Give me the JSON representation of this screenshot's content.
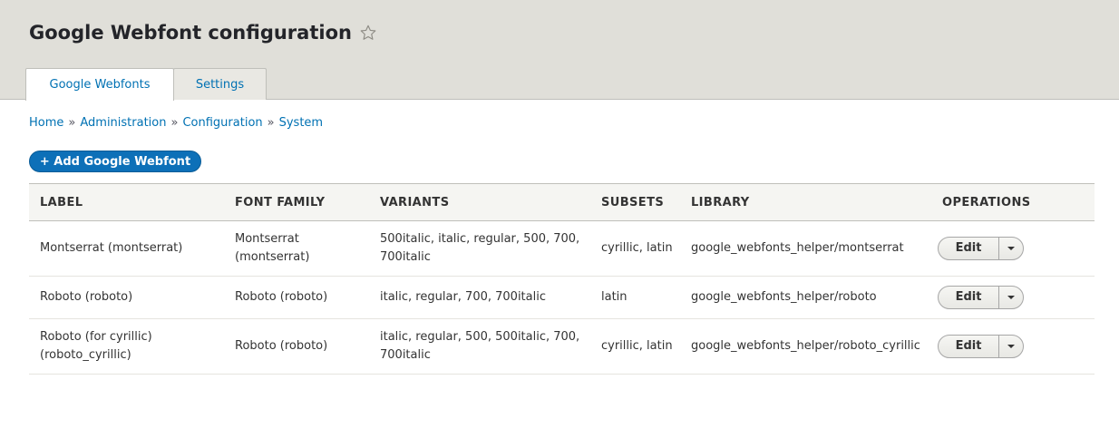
{
  "page": {
    "title": "Google Webfont configuration"
  },
  "tabs": [
    {
      "label": "Google Webfonts",
      "active": true
    },
    {
      "label": "Settings",
      "active": false
    }
  ],
  "breadcrumb": {
    "items": [
      "Home",
      "Administration",
      "Configuration",
      "System"
    ],
    "separator": "»"
  },
  "actions": {
    "add_label": "+ Add Google Webfont"
  },
  "table": {
    "columns": [
      "LABEL",
      "FONT FAMILY",
      "VARIANTS",
      "SUBSETS",
      "LIBRARY",
      "OPERATIONS"
    ],
    "rows": [
      {
        "label": "Montserrat (montserrat)",
        "font_family": "Montserrat (montserrat)",
        "variants": "500italic, italic, regular, 500, 700, 700italic",
        "subsets": "cyrillic, latin",
        "library": "google_webfonts_helper/montserrat",
        "operation": "Edit"
      },
      {
        "label": "Roboto (roboto)",
        "font_family": "Roboto (roboto)",
        "variants": "italic, regular, 700, 700italic",
        "subsets": "latin",
        "library": "google_webfonts_helper/roboto",
        "operation": "Edit"
      },
      {
        "label": "Roboto (for cyrillic) (roboto_cyrillic)",
        "font_family": "Roboto (roboto)",
        "variants": "italic, regular, 500, 500italic, 700, 700italic",
        "subsets": "cyrillic, latin",
        "library": "google_webfonts_helper/roboto_cyrillic",
        "operation": "Edit"
      }
    ]
  },
  "colors": {
    "header_bg": "#e0dfd9",
    "link": "#0071b3",
    "primary_button": "#0d70b8"
  },
  "icons": {
    "favorite": "star-outline-icon",
    "dropdown": "chevron-down-icon"
  }
}
